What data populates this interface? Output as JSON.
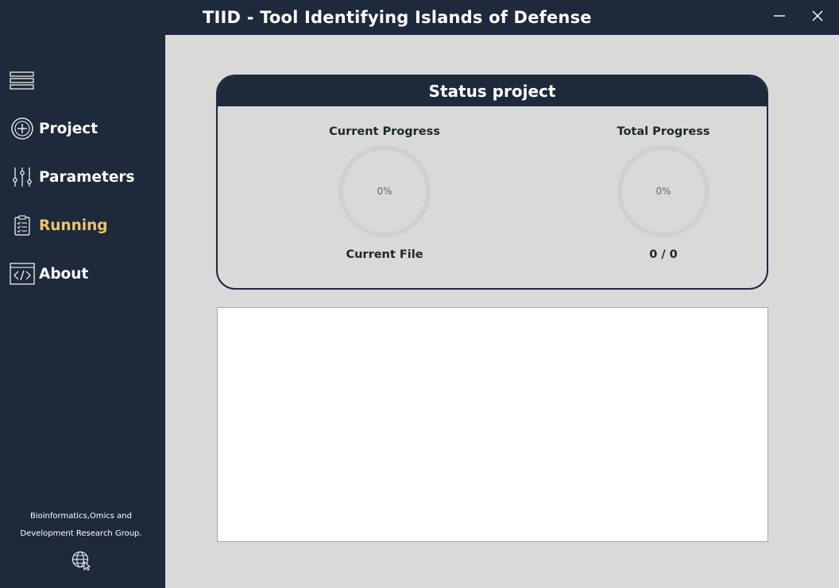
{
  "app": {
    "title": "TIID - Tool Identifying Islands of Defense"
  },
  "window_controls": {
    "minimize_icon": "minimize-icon",
    "close_icon": "close-icon"
  },
  "sidebar": {
    "menu_icon": "hamburger-menu-icon",
    "items": [
      {
        "label": "Project",
        "icon": "add-circle-icon",
        "active": false
      },
      {
        "label": "Parameters",
        "icon": "sliders-icon",
        "active": false
      },
      {
        "label": "Running",
        "icon": "clipboard-checklist-icon",
        "active": true
      },
      {
        "label": "About",
        "icon": "code-icon",
        "active": false
      }
    ],
    "footer": {
      "line1": "Bioinformatics,Omics and",
      "line2": "Development Research Group.",
      "link_icon": "globe-icon"
    }
  },
  "status": {
    "title": "Status project",
    "current": {
      "label": "Current Progress",
      "percent_text": "0%",
      "value": 0
    },
    "total": {
      "label": "Total Progress",
      "percent_text": "0%",
      "value": 0
    },
    "current_file_label": "Current File",
    "count_text": "0 / 0"
  },
  "log": {
    "text": ""
  },
  "colors": {
    "dark": "#1e293b",
    "accent": "#f0c36a",
    "background": "#d9d9d9",
    "ring_track": "#d0d0d0"
  }
}
